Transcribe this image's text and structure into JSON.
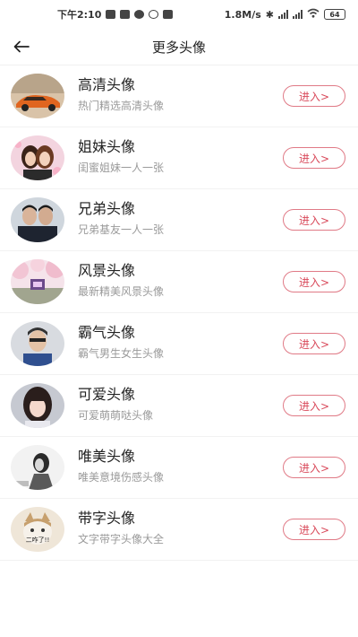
{
  "status_bar": {
    "time": "下午2:10",
    "speed": "1.8M/s",
    "battery": "64"
  },
  "header": {
    "title": "更多头像"
  },
  "categories": [
    {
      "title": "高清头像",
      "subtitle": "热门精选高清头像",
      "button": "进入>",
      "avatar": "sports-car"
    },
    {
      "title": "姐妹头像",
      "subtitle": "闺蜜姐妹一人一张",
      "button": "进入>",
      "avatar": "two-girls"
    },
    {
      "title": "兄弟头像",
      "subtitle": "兄弟基友一人一张",
      "button": "进入>",
      "avatar": "two-boys"
    },
    {
      "title": "风景头像",
      "subtitle": "最新精美风景头像",
      "button": "进入>",
      "avatar": "cherry-blossom"
    },
    {
      "title": "霸气头像",
      "subtitle": "霸气男生女生头像",
      "button": "进入>",
      "avatar": "cool-guy"
    },
    {
      "title": "可爱头像",
      "subtitle": "可爱萌萌哒头像",
      "button": "进入>",
      "avatar": "cute-girl"
    },
    {
      "title": "唯美头像",
      "subtitle": "唯美意境伤感头像",
      "button": "进入>",
      "avatar": "sad-girl"
    },
    {
      "title": "带字头像",
      "subtitle": "文字带字头像大全",
      "button": "进入>",
      "avatar": "cat-with-text"
    }
  ],
  "avatar_text": "二咋了!!"
}
